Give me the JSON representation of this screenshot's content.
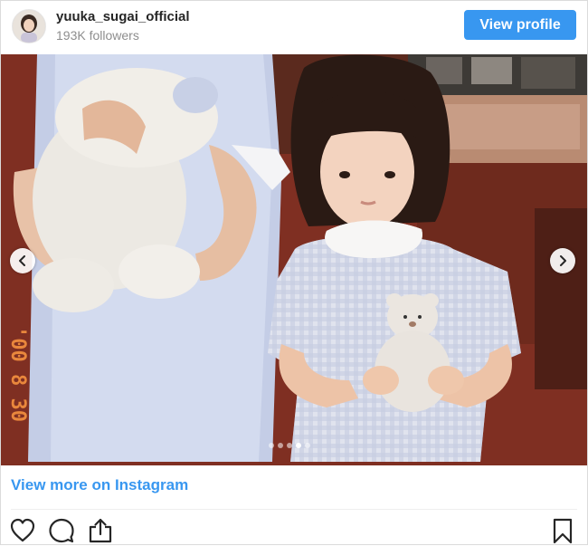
{
  "header": {
    "username": "yuuka_sugai_official",
    "followers": "193K followers",
    "view_profile_label": "View profile"
  },
  "carousel": {
    "slide_count": 5,
    "active_index": 3,
    "date_stamp": "'00 8 30"
  },
  "footer": {
    "view_more_label": "View more on Instagram"
  },
  "icons": {
    "like": "heart-icon",
    "comment": "comment-icon",
    "share": "share-icon",
    "save": "bookmark-icon",
    "prev": "chevron-left-icon",
    "next": "chevron-right-icon"
  },
  "colors": {
    "accent": "#3897f0",
    "text": "#262626",
    "muted": "#8e8e8e"
  }
}
